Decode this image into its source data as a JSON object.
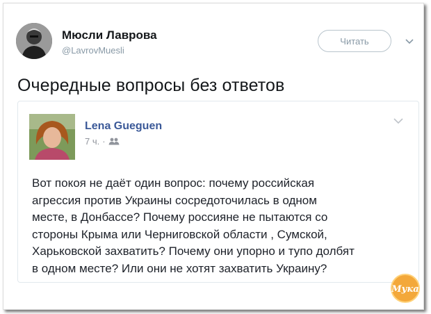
{
  "tweet": {
    "author_name": "Мюсли Лаврова",
    "author_handle": "@LavrovMuesli",
    "follow_label": "Читать",
    "text": "Очередные вопросы без ответов"
  },
  "quoted_post": {
    "author_name": "Lena Gueguen",
    "timestamp": "7 ч.",
    "separator": "·",
    "body_lines": [
      "Вот покоя не даёт один вопрос: почему российская",
      "агрессия против Украины сосредоточилась в одном",
      "месте, в Донбассе? Почему россияне не пытаются со",
      "стороны Крыма или Черниговской области , Сумской,",
      "Харьковской захватить? Почему они упорно и тупо долбят",
      "в одном месте? Или они не хотят захватить Украину?"
    ]
  },
  "watermark_text": "Мука",
  "icons": [
    "chevron-down-icon",
    "friends-icon",
    "logo-icon"
  ],
  "colors": {
    "fb_name": "#3b5998",
    "handle": "#8899a6",
    "watermark": "#f0a030"
  }
}
